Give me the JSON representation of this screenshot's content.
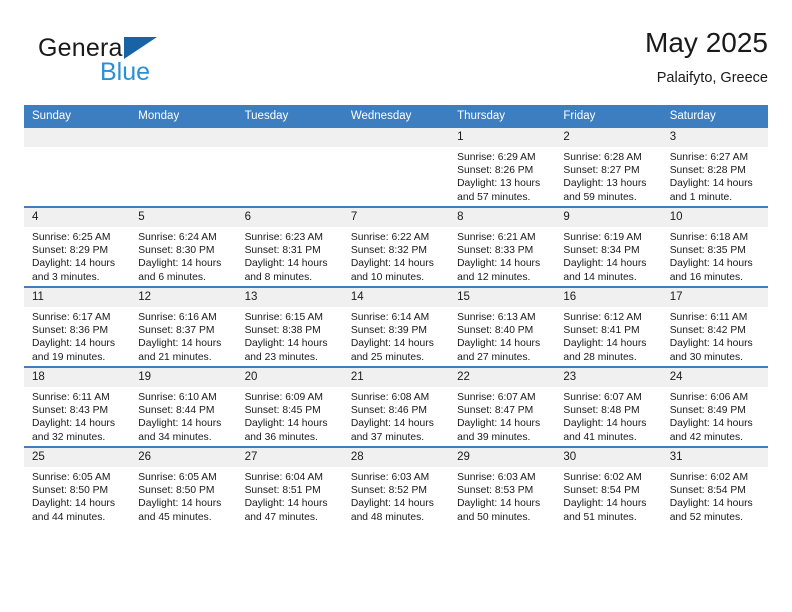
{
  "brand": {
    "word_general": "General",
    "word_blue": "Blue",
    "logo_icon": "triangle-flag-icon",
    "accent_dark": "#1763a6",
    "accent_light": "#2b8fd4"
  },
  "header": {
    "title": "May 2025",
    "subtitle": "Palaifyto, Greece"
  },
  "theme": {
    "header_blue": "#3c7ebf",
    "daynum_band": "#f0f0f0",
    "text": "#1a1a1a"
  },
  "calendar": {
    "weekday_headers": [
      "Sunday",
      "Monday",
      "Tuesday",
      "Wednesday",
      "Thursday",
      "Friday",
      "Saturday"
    ],
    "weeks": [
      [
        {
          "day": "",
          "lines": []
        },
        {
          "day": "",
          "lines": []
        },
        {
          "day": "",
          "lines": []
        },
        {
          "day": "",
          "lines": []
        },
        {
          "day": "1",
          "lines": [
            "Sunrise: 6:29 AM",
            "Sunset: 8:26 PM",
            "Daylight: 13 hours",
            "and 57 minutes."
          ]
        },
        {
          "day": "2",
          "lines": [
            "Sunrise: 6:28 AM",
            "Sunset: 8:27 PM",
            "Daylight: 13 hours",
            "and 59 minutes."
          ]
        },
        {
          "day": "3",
          "lines": [
            "Sunrise: 6:27 AM",
            "Sunset: 8:28 PM",
            "Daylight: 14 hours",
            "and 1 minute."
          ]
        }
      ],
      [
        {
          "day": "4",
          "lines": [
            "Sunrise: 6:25 AM",
            "Sunset: 8:29 PM",
            "Daylight: 14 hours",
            "and 3 minutes."
          ]
        },
        {
          "day": "5",
          "lines": [
            "Sunrise: 6:24 AM",
            "Sunset: 8:30 PM",
            "Daylight: 14 hours",
            "and 6 minutes."
          ]
        },
        {
          "day": "6",
          "lines": [
            "Sunrise: 6:23 AM",
            "Sunset: 8:31 PM",
            "Daylight: 14 hours",
            "and 8 minutes."
          ]
        },
        {
          "day": "7",
          "lines": [
            "Sunrise: 6:22 AM",
            "Sunset: 8:32 PM",
            "Daylight: 14 hours",
            "and 10 minutes."
          ]
        },
        {
          "day": "8",
          "lines": [
            "Sunrise: 6:21 AM",
            "Sunset: 8:33 PM",
            "Daylight: 14 hours",
            "and 12 minutes."
          ]
        },
        {
          "day": "9",
          "lines": [
            "Sunrise: 6:19 AM",
            "Sunset: 8:34 PM",
            "Daylight: 14 hours",
            "and 14 minutes."
          ]
        },
        {
          "day": "10",
          "lines": [
            "Sunrise: 6:18 AM",
            "Sunset: 8:35 PM",
            "Daylight: 14 hours",
            "and 16 minutes."
          ]
        }
      ],
      [
        {
          "day": "11",
          "lines": [
            "Sunrise: 6:17 AM",
            "Sunset: 8:36 PM",
            "Daylight: 14 hours",
            "and 19 minutes."
          ]
        },
        {
          "day": "12",
          "lines": [
            "Sunrise: 6:16 AM",
            "Sunset: 8:37 PM",
            "Daylight: 14 hours",
            "and 21 minutes."
          ]
        },
        {
          "day": "13",
          "lines": [
            "Sunrise: 6:15 AM",
            "Sunset: 8:38 PM",
            "Daylight: 14 hours",
            "and 23 minutes."
          ]
        },
        {
          "day": "14",
          "lines": [
            "Sunrise: 6:14 AM",
            "Sunset: 8:39 PM",
            "Daylight: 14 hours",
            "and 25 minutes."
          ]
        },
        {
          "day": "15",
          "lines": [
            "Sunrise: 6:13 AM",
            "Sunset: 8:40 PM",
            "Daylight: 14 hours",
            "and 27 minutes."
          ]
        },
        {
          "day": "16",
          "lines": [
            "Sunrise: 6:12 AM",
            "Sunset: 8:41 PM",
            "Daylight: 14 hours",
            "and 28 minutes."
          ]
        },
        {
          "day": "17",
          "lines": [
            "Sunrise: 6:11 AM",
            "Sunset: 8:42 PM",
            "Daylight: 14 hours",
            "and 30 minutes."
          ]
        }
      ],
      [
        {
          "day": "18",
          "lines": [
            "Sunrise: 6:11 AM",
            "Sunset: 8:43 PM",
            "Daylight: 14 hours",
            "and 32 minutes."
          ]
        },
        {
          "day": "19",
          "lines": [
            "Sunrise: 6:10 AM",
            "Sunset: 8:44 PM",
            "Daylight: 14 hours",
            "and 34 minutes."
          ]
        },
        {
          "day": "20",
          "lines": [
            "Sunrise: 6:09 AM",
            "Sunset: 8:45 PM",
            "Daylight: 14 hours",
            "and 36 minutes."
          ]
        },
        {
          "day": "21",
          "lines": [
            "Sunrise: 6:08 AM",
            "Sunset: 8:46 PM",
            "Daylight: 14 hours",
            "and 37 minutes."
          ]
        },
        {
          "day": "22",
          "lines": [
            "Sunrise: 6:07 AM",
            "Sunset: 8:47 PM",
            "Daylight: 14 hours",
            "and 39 minutes."
          ]
        },
        {
          "day": "23",
          "lines": [
            "Sunrise: 6:07 AM",
            "Sunset: 8:48 PM",
            "Daylight: 14 hours",
            "and 41 minutes."
          ]
        },
        {
          "day": "24",
          "lines": [
            "Sunrise: 6:06 AM",
            "Sunset: 8:49 PM",
            "Daylight: 14 hours",
            "and 42 minutes."
          ]
        }
      ],
      [
        {
          "day": "25",
          "lines": [
            "Sunrise: 6:05 AM",
            "Sunset: 8:50 PM",
            "Daylight: 14 hours",
            "and 44 minutes."
          ]
        },
        {
          "day": "26",
          "lines": [
            "Sunrise: 6:05 AM",
            "Sunset: 8:50 PM",
            "Daylight: 14 hours",
            "and 45 minutes."
          ]
        },
        {
          "day": "27",
          "lines": [
            "Sunrise: 6:04 AM",
            "Sunset: 8:51 PM",
            "Daylight: 14 hours",
            "and 47 minutes."
          ]
        },
        {
          "day": "28",
          "lines": [
            "Sunrise: 6:03 AM",
            "Sunset: 8:52 PM",
            "Daylight: 14 hours",
            "and 48 minutes."
          ]
        },
        {
          "day": "29",
          "lines": [
            "Sunrise: 6:03 AM",
            "Sunset: 8:53 PM",
            "Daylight: 14 hours",
            "and 50 minutes."
          ]
        },
        {
          "day": "30",
          "lines": [
            "Sunrise: 6:02 AM",
            "Sunset: 8:54 PM",
            "Daylight: 14 hours",
            "and 51 minutes."
          ]
        },
        {
          "day": "31",
          "lines": [
            "Sunrise: 6:02 AM",
            "Sunset: 8:54 PM",
            "Daylight: 14 hours",
            "and 52 minutes."
          ]
        }
      ]
    ]
  }
}
